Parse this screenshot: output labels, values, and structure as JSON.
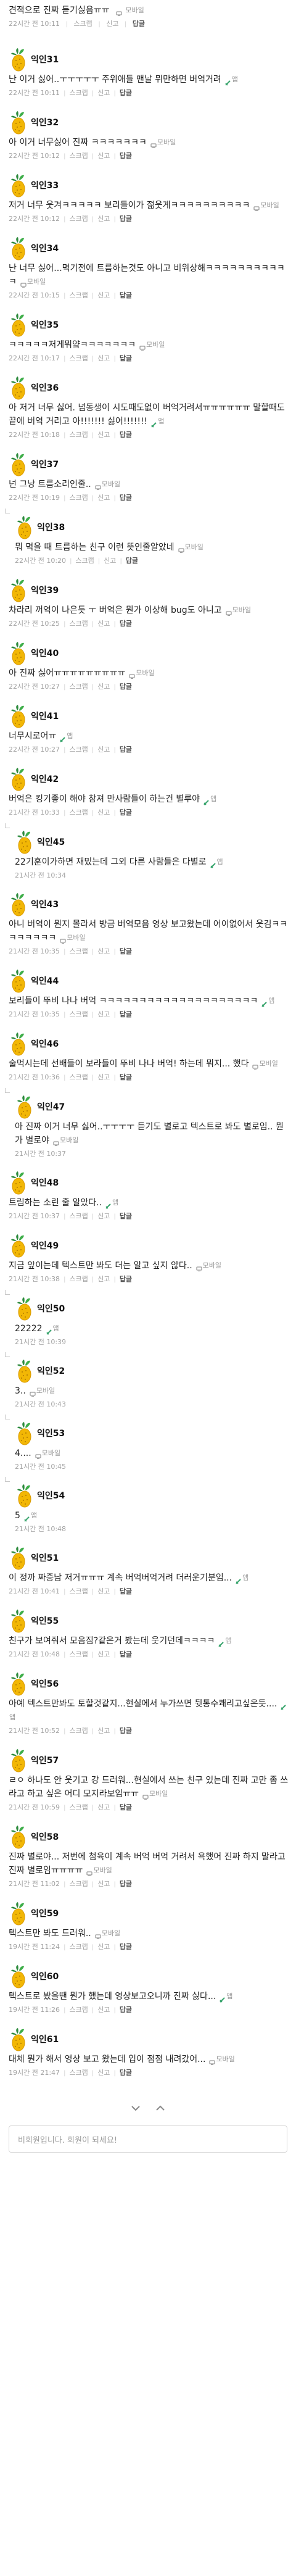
{
  "first_tail": {
    "text": "견적으로 진짜 듣기싫음ㅠㅠ",
    "device": "모바일",
    "time": "22시간 전 10:11",
    "actions": [
      "스크랩",
      "신고",
      "답글"
    ]
  },
  "comments": [
    {
      "nick": "익인31",
      "reply": false,
      "lines": [
        "난 이거 싫어..ㅜㅜㅜㅜㅜ 주위애들 맨날 뮈만하면 버억거려"
      ],
      "mark": "phone",
      "device": "앱",
      "time": "22시간 전 10:11",
      "actions": [
        "스크랩",
        "신고",
        "답글"
      ]
    },
    {
      "nick": "익인32",
      "reply": false,
      "lines": [
        "아 이거 너무싫어 진짜 ㅋㅋㅋㅋㅋㅋㅋ"
      ],
      "mark": "pc",
      "device": "모바일",
      "time": "22시간 전 10:12",
      "actions": [
        "스크랩",
        "신고",
        "답글"
      ]
    },
    {
      "nick": "익인33",
      "reply": false,
      "lines": [
        "저거 너무 웃겨ㅋㅋㅋㅋㅋ 보리들이가 젊웃게ㅋㅋㅋㅋㅋㅋㅋㅋㅋㅋ"
      ],
      "mark": "pc",
      "device": "모바일",
      "time": "22시간 전 10:12",
      "actions": [
        "스크랩",
        "신고",
        "답글"
      ]
    },
    {
      "nick": "익인34",
      "reply": false,
      "lines": [
        "난 너무 싫어...먹기전에 트름하는것도 아니고 비위상해ㅋㅋㅋㅋㅋㅋㅋㅋㅋㅋㅋ"
      ],
      "mark": "pc",
      "device": "모바일",
      "time": "22시간 전 10:15",
      "actions": [
        "스크랩",
        "신고",
        "답글"
      ]
    },
    {
      "nick": "익인35",
      "reply": false,
      "lines": [
        "ㅋㅋㅋㅋㅋ저게뭐얔ㅋㅋㅋㅋㅋㅋㅋ"
      ],
      "mark": "pc",
      "device": "모바일",
      "time": "22시간 전 10:17",
      "actions": [
        "스크랩",
        "신고",
        "답글"
      ]
    },
    {
      "nick": "익인36",
      "reply": false,
      "lines": [
        "아 저거 너무 싫어. 넘동생이 시도때도없이 버억거려서ㅠㅠㅠㅠㅠㅠ 말할때도 끝에 버억 거리고 아!!!!!!! 싫어!!!!!!!"
      ],
      "mark": "phone",
      "device": "앱",
      "time": "22시간 전 10:18",
      "actions": [
        "스크랩",
        "신고",
        "답글"
      ]
    },
    {
      "nick": "익인37",
      "reply": false,
      "lines": [
        "넌 그냥 트름소리인줄.."
      ],
      "mark": "pc",
      "device": "모바일",
      "time": "22시간 전 10:19",
      "actions": [
        "스크랩",
        "신고",
        "답글"
      ]
    },
    {
      "nick": "익인38",
      "reply": true,
      "lines": [
        "뭐 먹을 때 트름하는 친구 이런 뜻인줄알았네"
      ],
      "mark": "pc",
      "device": "모바일",
      "time": "22시간 전 10:20",
      "actions": [
        "스크랩",
        "신고",
        "답글"
      ]
    },
    {
      "nick": "익인39",
      "reply": false,
      "lines": [
        "차라리 꺼억이 나은듯 ㅜ 버억은 뭔가 이상해 bug도 아니고"
      ],
      "mark": "pc",
      "device": "모바일",
      "time": "22시간 전 10:25",
      "actions": [
        "스크랩",
        "신고",
        "답글"
      ]
    },
    {
      "nick": "익인40",
      "reply": false,
      "lines": [
        "아 진짜 싫어ㅠㅠㅠㅠㅠㅠㅠㅠㅠ"
      ],
      "mark": "pc",
      "device": "모바일",
      "time": "22시간 전 10:27",
      "actions": [
        "스크랩",
        "신고",
        "답글"
      ]
    },
    {
      "nick": "익인41",
      "reply": false,
      "lines": [
        "너무시로어ㅠ"
      ],
      "mark": "phone",
      "device": "앱",
      "time": "22시간 전 10:27",
      "actions": [
        "스크랩",
        "신고",
        "답글"
      ]
    },
    {
      "nick": "익인42",
      "reply": false,
      "lines": [
        "버억은 킹기좋이 해야 참져 만사람들이 하는건 별루야"
      ],
      "mark": "phone",
      "device": "앱",
      "time": "21시간 전 10:33",
      "actions": [
        "스크랩",
        "신고",
        "답글"
      ]
    },
    {
      "nick": "익인45",
      "reply": true,
      "lines": [
        "22기훈이가하면 재밌는데 그외 다른 사람들은 다별로"
      ],
      "mark": "phone",
      "device": "앱",
      "time": "21시간 전 10:34",
      "actions": []
    },
    {
      "nick": "익인43",
      "reply": false,
      "lines": [
        "아니 버억이 뭔지 몰라서 방금 버억모음 영상 보고왔는데 어이없어서 웃김ㅋㅋㅋㅋㅋㅋㅋㅋ"
      ],
      "mark": "pc",
      "device": "모바일",
      "time": "21시간 전 10:35",
      "actions": [
        "스크랩",
        "신고",
        "답글"
      ]
    },
    {
      "nick": "익인44",
      "reply": false,
      "lines": [
        "보리들이 뚜비 나나 버억 ㅋㅋㅋㅋㅋㅋㅋㅋㅋㅋㅋㅋㅋㅋㅋㅋㅋㅋㅋㅋ"
      ],
      "mark": "phone",
      "device": "앱",
      "time": "21시간 전 10:35",
      "actions": [
        "스크랩",
        "신고",
        "답글"
      ]
    },
    {
      "nick": "익인46",
      "reply": false,
      "lines": [
        "술먹시는데 선배들이 보라들이 뚜비 나나 버억! 하는데 뭐지... 했다"
      ],
      "mark": "pc",
      "device": "모바일",
      "time": "21시간 전 10:36",
      "actions": [
        "스크랩",
        "신고",
        "답글"
      ]
    },
    {
      "nick": "익인47",
      "reply": true,
      "lines": [
        "아 진짜 이거 너무 싫어..ㅜㅜㅜㅜ 듣기도 별로고 텍스트로 봐도 별로임.. 뭔가 별로야"
      ],
      "mark": "pc",
      "device": "모바일",
      "time": "21시간 전 10:37",
      "actions": []
    },
    {
      "nick": "익인48",
      "reply": false,
      "lines": [
        "트림하는 소린 줄 알았다.."
      ],
      "mark": "phone",
      "device": "앱",
      "time": "21시간 전 10:37",
      "actions": [
        "스크랩",
        "신고",
        "답글"
      ]
    },
    {
      "nick": "익인49",
      "reply": false,
      "lines": [
        "지금 앞이는데 텍스트만 봐도 더는 알고 싶지 않다.."
      ],
      "mark": "pc",
      "device": "모바일",
      "time": "21시간 전 10:38",
      "actions": [
        "스크랩",
        "신고",
        "답글"
      ]
    },
    {
      "nick": "익인50",
      "reply": true,
      "lines": [
        "22222"
      ],
      "mark": "phone",
      "device": "앱",
      "time": "21시간 전 10:39",
      "actions": []
    },
    {
      "nick": "익인52",
      "reply": true,
      "lines": [
        "3.."
      ],
      "mark": "pc",
      "device": "모바일",
      "time": "21시간 전 10:43",
      "actions": []
    },
    {
      "nick": "익인53",
      "reply": true,
      "lines": [
        "4...."
      ],
      "mark": "pc",
      "device": "모바일",
      "time": "21시간 전 10:45",
      "actions": []
    },
    {
      "nick": "익인54",
      "reply": true,
      "lines": [
        "5"
      ],
      "mark": "phone",
      "device": "앱",
      "time": "21시간 전 10:48",
      "actions": []
    },
    {
      "nick": "익인51",
      "reply": false,
      "lines": [
        "이 정까 짜증남 저거ㅠㅠㅠ 계속 버억버억거려 더러운기분임..."
      ],
      "mark": "phone",
      "device": "앱",
      "time": "21시간 전 10:41",
      "actions": [
        "스크랩",
        "신고",
        "답글"
      ]
    },
    {
      "nick": "익인55",
      "reply": false,
      "lines": [
        "친구가 보여줘서 모음짐?같은거 봤는데 웃기던데ㅋㅋㅋㅋ"
      ],
      "mark": "phone",
      "device": "앱",
      "time": "21시간 전 10:48",
      "actions": [
        "스크랩",
        "신고",
        "답글"
      ]
    },
    {
      "nick": "익인56",
      "reply": false,
      "lines": [
        "아예 텍스트만봐도 토할것같지...현실에서 누가쓰면 뒷통수쾌리고싶은듯...."
      ],
      "mark": "phone",
      "device": "앱",
      "time": "21시간 전 10:52",
      "actions": [
        "스크랩",
        "신고",
        "답글"
      ]
    },
    {
      "nick": "익인57",
      "reply": false,
      "lines": [
        "ㄹㅇ 하나도 안 웃기고 걍 드러워...현실에서 쓰는 친구 있는데 진짜 고만 좀 쓰라고 하고 싶은 어디 모지라보임ㅠㅠ"
      ],
      "mark": "pc",
      "device": "모바일",
      "time": "21시간 전 10:59",
      "actions": [
        "스크랩",
        "신고",
        "답글"
      ]
    },
    {
      "nick": "익인58",
      "reply": false,
      "lines": [
        "진짜 별로야... 저번에 첨육이 계속 버억 버억 거려서 욕했어 진짜 하지 말라고 진짜 별로임ㅠㅠㅠㅠ"
      ],
      "mark": "pc",
      "device": "모바일",
      "time": "21시간 전 11:02",
      "actions": [
        "스크랩",
        "신고",
        "답글"
      ]
    },
    {
      "nick": "익인59",
      "reply": false,
      "lines": [
        "텍스트만 봐도 드러워.."
      ],
      "mark": "pc",
      "device": "모바일",
      "time": "19시간 전 11:24",
      "actions": [
        "스크랩",
        "신고",
        "답글"
      ]
    },
    {
      "nick": "익인60",
      "reply": false,
      "lines": [
        "텍스트로 봤을땐 뭔가 했는데 영상보고오니까 진짜 싫다..."
      ],
      "mark": "phone",
      "device": "앱",
      "time": "19시간 전 11:26",
      "actions": [
        "스크랩",
        "신고",
        "답글"
      ]
    },
    {
      "nick": "익인61",
      "reply": false,
      "lines": [
        "대체 뭔가 해서 영상 보고 왔는데 입이 점점 내려갔어..."
      ],
      "mark": "pc",
      "device": "모바일",
      "time": "19시간 전 21:47",
      "actions": [
        "스크랩",
        "신고",
        "답글"
      ]
    }
  ],
  "login_placeholder": "비회원입니다. 회원이 되세요!",
  "colors": {
    "meta": "#a3a3a3",
    "phone_mark": "#3aa56e",
    "pc_mark": "#9a9a9a"
  }
}
